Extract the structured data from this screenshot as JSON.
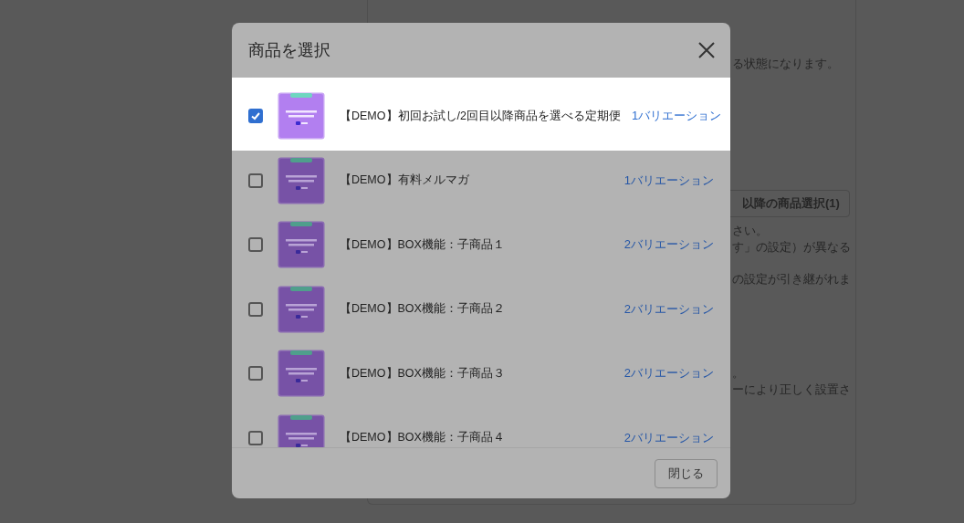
{
  "background_page": {
    "lines_top": [
      "る状態になります。"
    ],
    "button": "以降の商品選択(1)",
    "lines_middle": [
      "さい。",
      "す」の設定）が異なる"
    ],
    "lines_lower": [
      "の設定が引き継がれま"
    ],
    "lines_bottom": [
      "。",
      "ーにより正しく設置さ"
    ]
  },
  "dialog": {
    "title": "商品を選択",
    "products": [
      {
        "name": "【DEMO】初回お試し/2回目以降商品を選べる定期便",
        "variations": "1バリエーション",
        "checked": true,
        "highlighted": true
      },
      {
        "name": "【DEMO】有料メルマガ",
        "variations": "1バリエーション",
        "checked": false,
        "highlighted": false
      },
      {
        "name": "【DEMO】BOX機能：子商品１",
        "variations": "2バリエーション",
        "checked": false,
        "highlighted": false
      },
      {
        "name": "【DEMO】BOX機能：子商品２",
        "variations": "2バリエーション",
        "checked": false,
        "highlighted": false
      },
      {
        "name": "【DEMO】BOX機能：子商品３",
        "variations": "2バリエーション",
        "checked": false,
        "highlighted": false
      },
      {
        "name": "【DEMO】BOX機能：子商品４",
        "variations": "2バリエーション",
        "checked": false,
        "highlighted": false
      }
    ],
    "close_button": "閉じる"
  }
}
